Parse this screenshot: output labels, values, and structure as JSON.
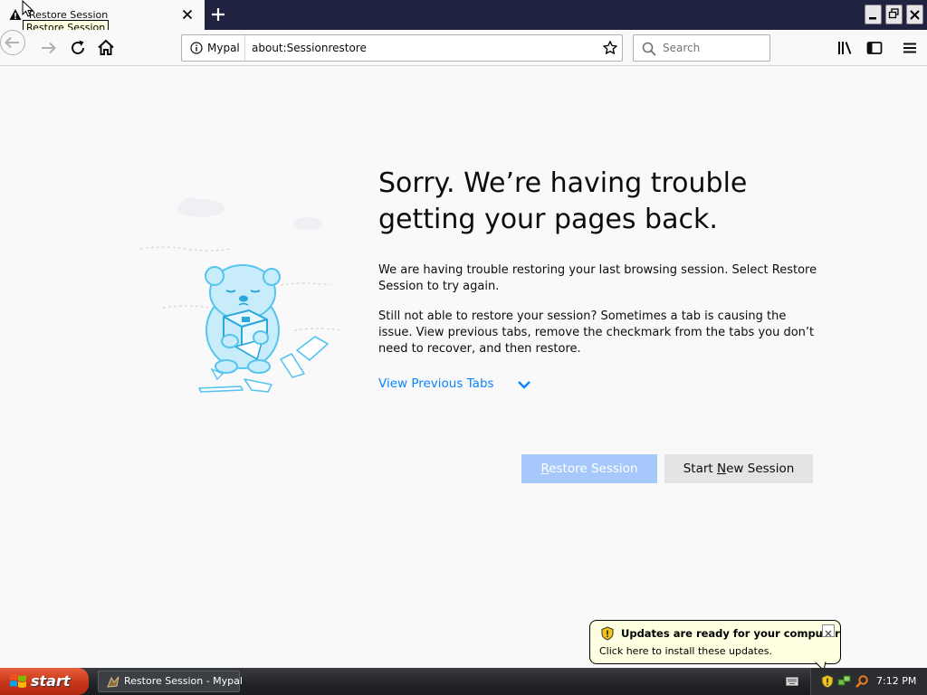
{
  "tab": {
    "title": "Restore Session",
    "tooltip": "Restore Session"
  },
  "navbar": {
    "identity_label": "Mypal",
    "url": "about:Sessionrestore",
    "search_placeholder": "Search"
  },
  "content": {
    "heading": "Sorry. We’re having trouble getting your pages back.",
    "paragraph1": "We are having trouble restoring your last browsing session. Select Restore Session to try again.",
    "paragraph2": "Still not able to restore your session? Sometimes a tab is causing the issue. View previous tabs, remove the checkmark from the tabs you don’t need to recover, and then restore.",
    "view_previous_tabs": "View Previous Tabs",
    "restore_button": {
      "first": "R",
      "rest": "estore Session"
    },
    "new_session_button": {
      "before": "Start ",
      "mnemonic": "N",
      "after": "ew Session"
    }
  },
  "balloon": {
    "title": "Updates are ready for your computer",
    "text": "Click here to install these updates."
  },
  "taskbar": {
    "start_label": "start",
    "task_label": "Restore Session - Mypal",
    "clock": "7:12 PM"
  },
  "colors": {
    "accent": "#0a84ff",
    "restore_button_bg": "#a6c8fb",
    "tabstrip_bg": "#202340",
    "taskbar_bg": "#222326",
    "start_button": "#c8351a",
    "balloon_bg": "#ffffe1"
  },
  "icons": {
    "tab": "warning-icon",
    "back": "arrow-left-icon",
    "forward": "arrow-right-icon",
    "reload": "reload-icon",
    "home": "home-icon",
    "identity": "info-icon",
    "bookmark": "star-icon",
    "search": "search-icon",
    "library": "library-icon",
    "sidebar": "sidebar-icon",
    "menu": "hamburger-menu-icon"
  }
}
